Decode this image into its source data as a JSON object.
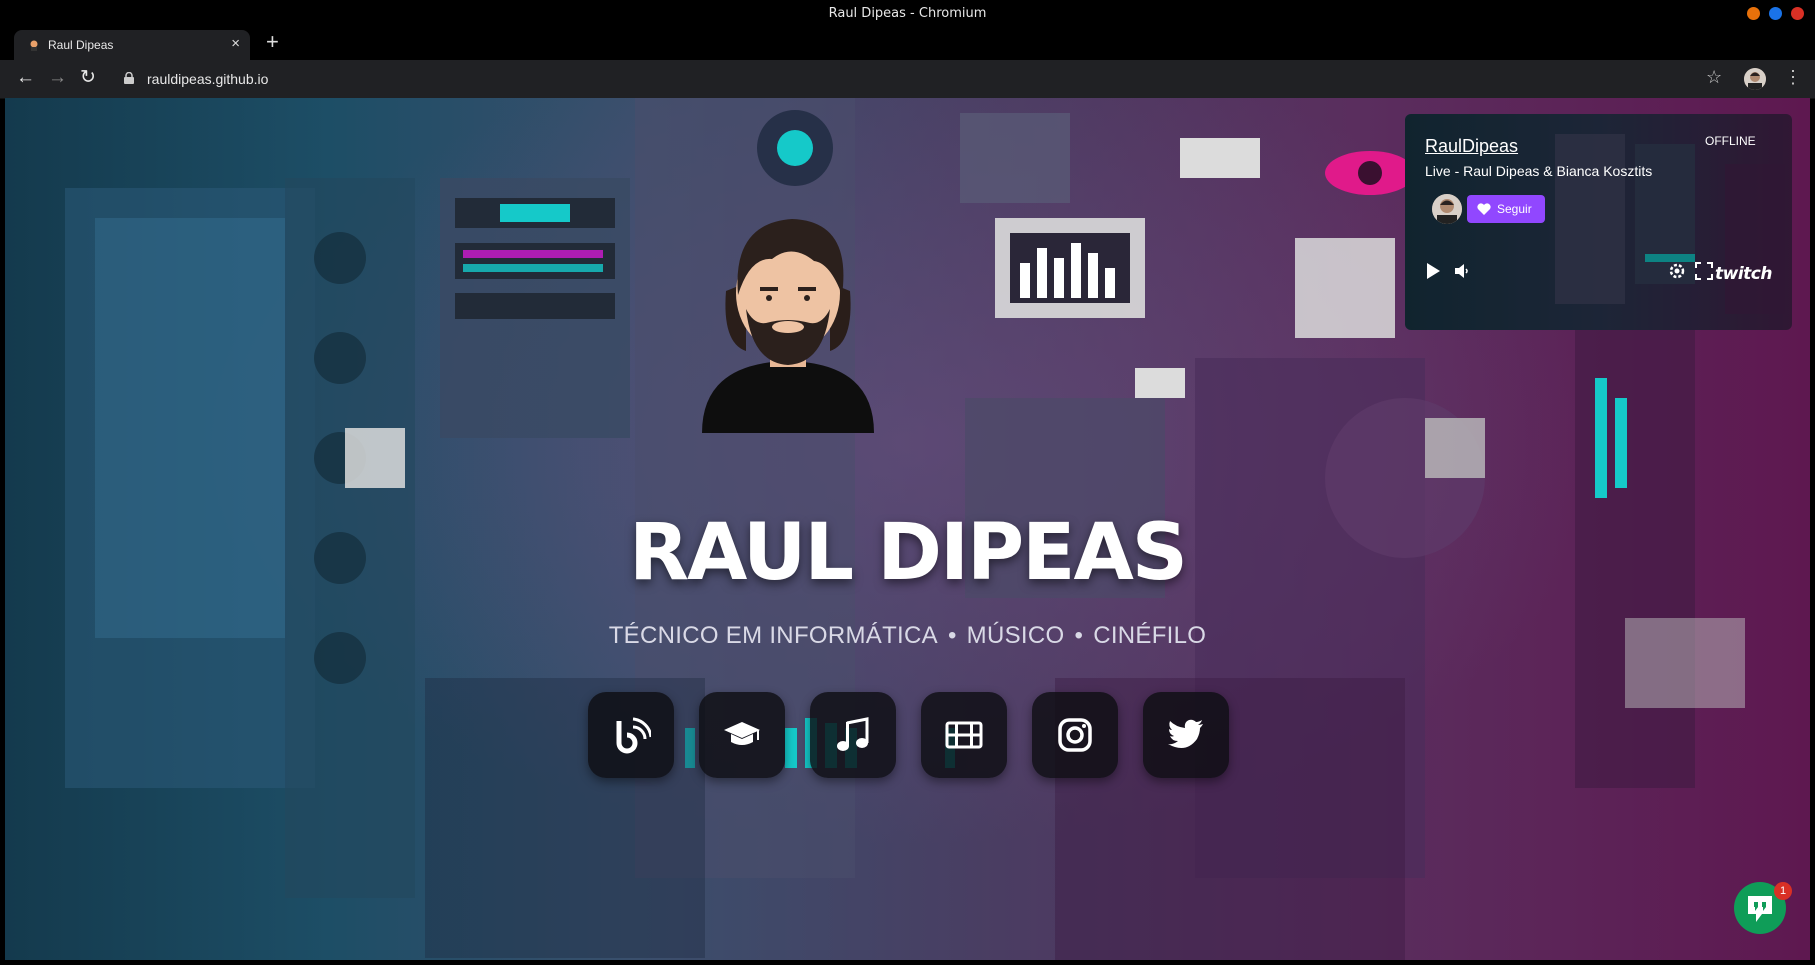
{
  "window": {
    "title": "Raul Dipeas - Chromium",
    "controls": {
      "minimize_color": "#e8710a",
      "maximize_color": "#1a73e8",
      "close_color": "#d93025"
    }
  },
  "tab": {
    "label": "Raul Dipeas",
    "close": "×",
    "new_tab": "+"
  },
  "toolbar": {
    "back": "←",
    "forward": "→",
    "reload": "↻",
    "url": "rauldipeas.github.io",
    "star": "☆",
    "menu": "⋮"
  },
  "twitch": {
    "channel": "RaulDipeas",
    "status": "OFFLINE",
    "stream_title": "Live - Raul Dipeas & Bianca Kosztits",
    "follow_label": "Seguir",
    "logo_text": "twitch",
    "accent": "#9147ff"
  },
  "hero": {
    "name": "RAUL DIPEAS",
    "roles": [
      "TÉCNICO EM INFORMÁTICA",
      "MÚSICO",
      "CINÉFILO"
    ],
    "separator": "•"
  },
  "social_icons": [
    "blog-icon",
    "graduation-cap-icon",
    "music-note-icon",
    "film-icon",
    "instagram-icon",
    "twitter-icon"
  ],
  "chat": {
    "badge_count": "1",
    "color": "#0f9d58"
  }
}
